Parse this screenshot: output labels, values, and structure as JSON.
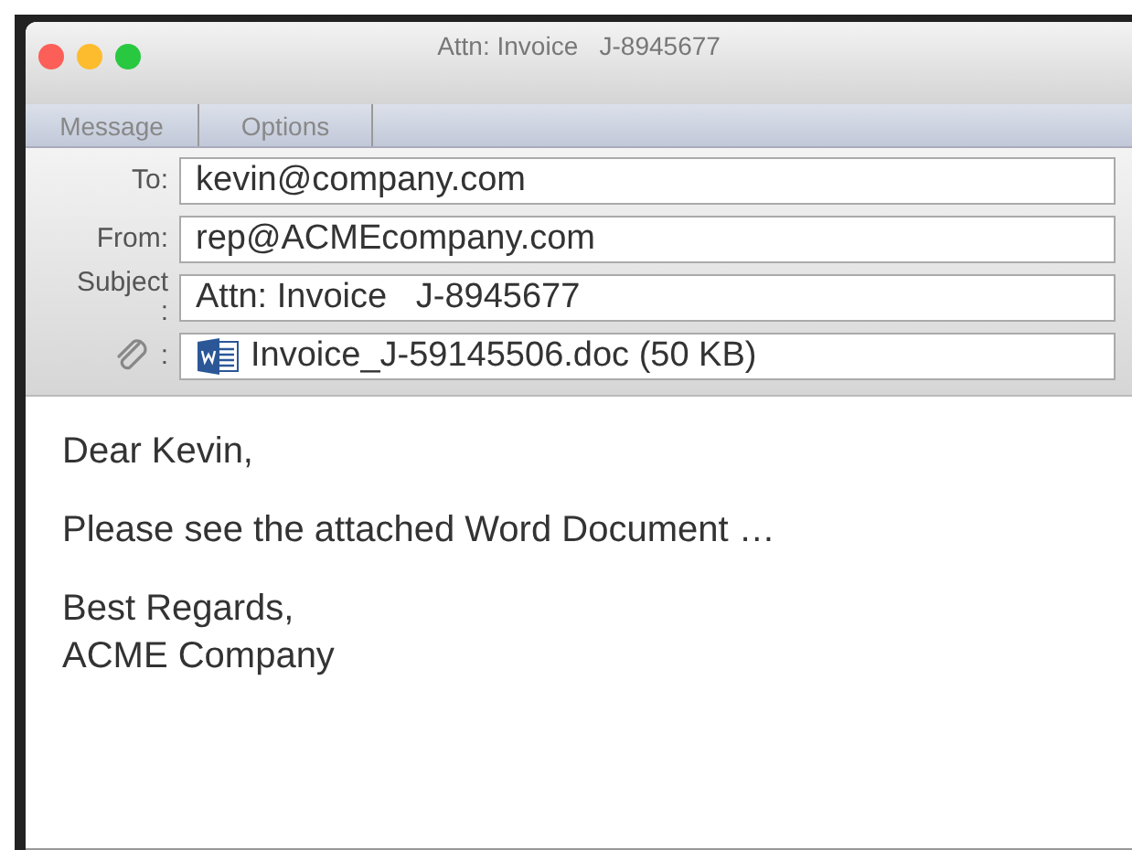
{
  "window": {
    "title": "Attn: Invoice   J-8945677"
  },
  "tabs": [
    {
      "label": "Message",
      "selected": false
    },
    {
      "label": "Options",
      "selected": false
    }
  ],
  "header_fields": [
    {
      "kind": "text",
      "label": "To:",
      "value": "kevin@company.com"
    },
    {
      "kind": "text",
      "label": "From:",
      "value": "rep@ACMEcompany.com"
    },
    {
      "kind": "text",
      "label": "Subject :",
      "value": "Attn: Invoice   J-8945677"
    },
    {
      "kind": "attachment",
      "label": ":",
      "value": "Invoice_J-59145506.doc (50 KB)"
    }
  ],
  "body": [
    "Dear Kevin,",
    "Please see the attached Word Document …",
    "Best Regards,\nACME Company"
  ]
}
